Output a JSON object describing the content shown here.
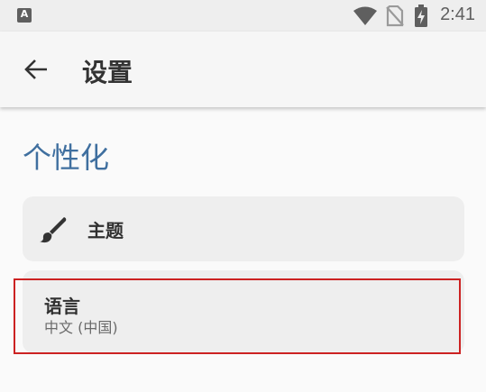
{
  "status_bar": {
    "app_icon": "A",
    "icons": [
      "wifi-icon",
      "no-sim-icon",
      "battery-charging-icon"
    ],
    "time": "2:41"
  },
  "app_bar": {
    "back_icon": "arrow-left-icon",
    "title": "设置"
  },
  "section": {
    "title": "个性化"
  },
  "items": [
    {
      "icon": "brush-icon",
      "label": "主题"
    },
    {
      "label": "语言",
      "sublabel": "中文 (中国)"
    }
  ],
  "colors": {
    "accent": "#3f6f9f",
    "highlight": "#cc2222"
  }
}
